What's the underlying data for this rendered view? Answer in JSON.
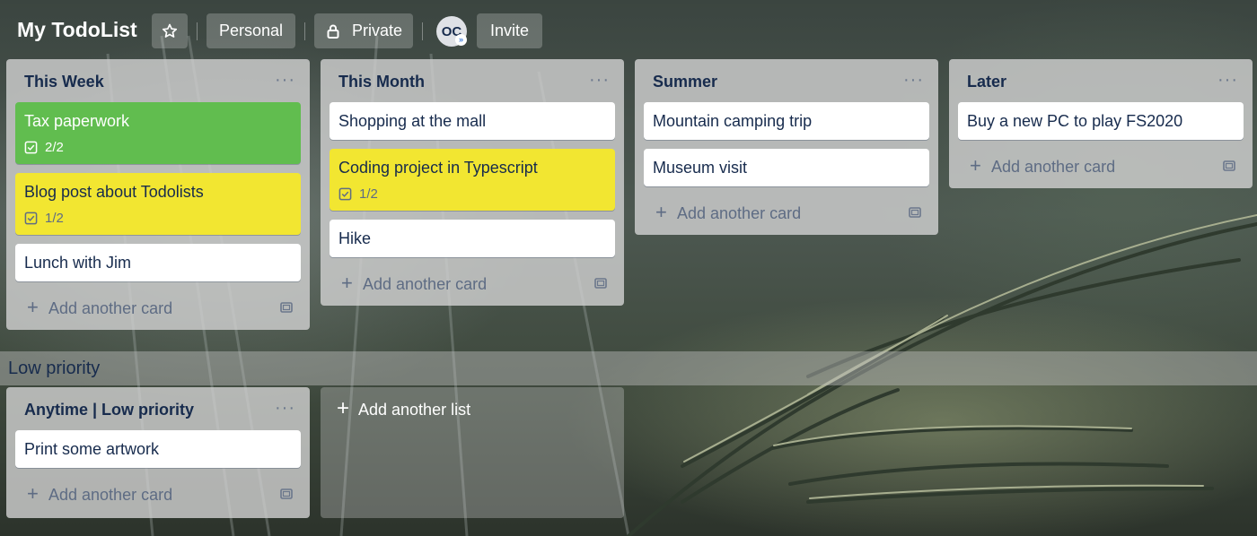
{
  "header": {
    "board_title": "My TodoList",
    "visibility_personal": "Personal",
    "visibility_private": "Private",
    "avatar_initials": "OC",
    "invite_label": "Invite"
  },
  "lists": [
    {
      "title": "This Week",
      "cards": [
        {
          "title": "Tax paperwork",
          "checklist": "2/2"
        },
        {
          "title": "Blog post about Todolists",
          "checklist": "1/2"
        },
        {
          "title": "Lunch with Jim"
        }
      ],
      "add_card_label": "Add another card"
    },
    {
      "title": "This Month",
      "cards": [
        {
          "title": "Shopping at the mall"
        },
        {
          "title": "Coding project in Typescript",
          "checklist": "1/2"
        },
        {
          "title": "Hike"
        }
      ],
      "add_card_label": "Add another card"
    },
    {
      "title": "Summer",
      "cards": [
        {
          "title": "Mountain camping trip"
        },
        {
          "title": "Museum visit"
        }
      ],
      "add_card_label": "Add another card"
    },
    {
      "title": "Later",
      "cards": [
        {
          "title": "Buy a new PC to play FS2020"
        }
      ],
      "add_card_label": "Add another card"
    }
  ],
  "sections": [
    {
      "label": "Low priority",
      "lists": [
        {
          "title": "Anytime | Low priority",
          "cards": [
            {
              "title": "Print some artwork"
            }
          ],
          "add_card_label": "Add another card"
        }
      ]
    }
  ],
  "add_list_label": "Add another list",
  "colors": {
    "card_green": "#61bd4f",
    "card_yellow": "#f2e631",
    "text_dark": "#172b4d"
  },
  "icons": {
    "star": "star-icon",
    "lock": "lock-icon",
    "checklist": "checklist-icon",
    "plus": "plus-icon",
    "menu": "more-horizontal-icon",
    "template": "card-template-icon"
  }
}
